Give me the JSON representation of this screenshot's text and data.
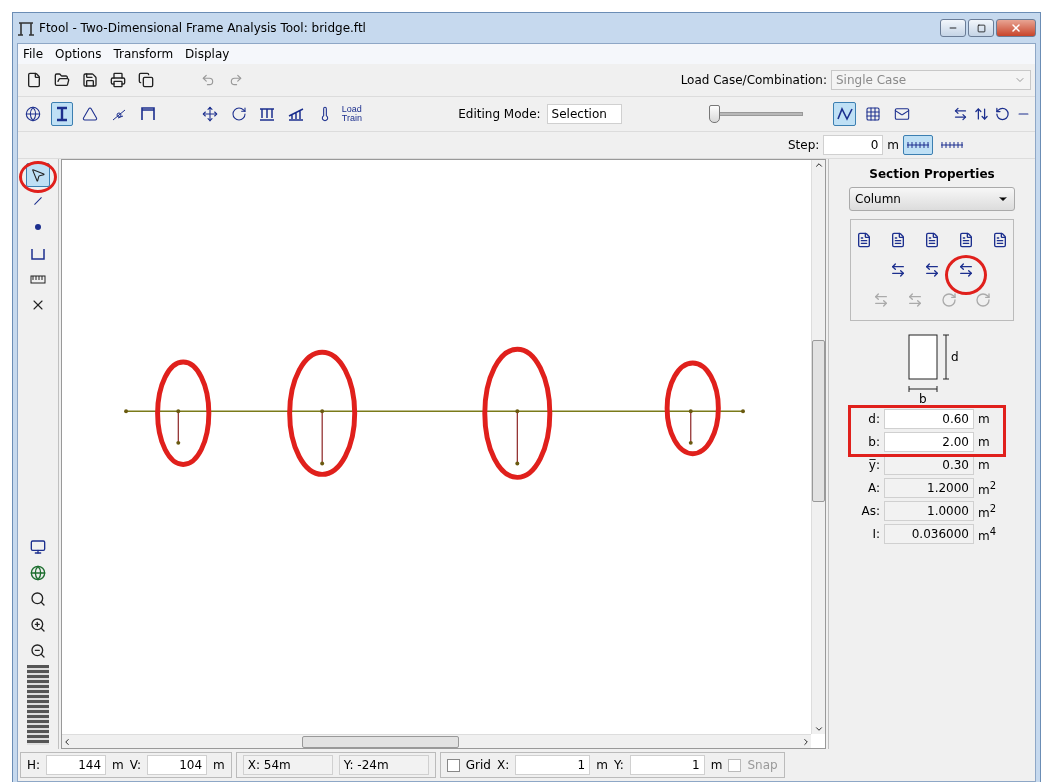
{
  "window": {
    "title": "Ftool - Two-Dimensional Frame Analysis Tool: bridge.ftl"
  },
  "menu": [
    "File",
    "Options",
    "Transform",
    "Display"
  ],
  "load_case": {
    "label": "Load Case/Combination:",
    "value": "Single Case",
    "disabled": true
  },
  "model_tools": [
    {
      "selected": false
    },
    {
      "selected": true
    },
    {
      "selected": false
    },
    {
      "selected": false
    },
    {
      "selected": false
    }
  ],
  "load_tools": [
    {
      "selected": false
    },
    {
      "selected": false
    },
    {
      "selected": false
    },
    {
      "selected": false
    },
    {
      "selected": false
    }
  ],
  "load_train": "Load\nTrain",
  "editing_mode": {
    "label": "Editing Mode:",
    "value": "Selection"
  },
  "slider": {
    "level": 0
  },
  "view_tools": [
    {
      "selected": true
    },
    {
      "selected": false
    },
    {
      "selected": false
    }
  ],
  "step": {
    "label": "Step:",
    "value": "0",
    "unit": "m"
  },
  "step_modes": [
    {
      "selected": true
    },
    {
      "selected": false
    }
  ],
  "side_tools": [
    {
      "selected": true
    },
    {
      "selected": false
    },
    {
      "selected": false
    },
    {
      "selected": false
    },
    {
      "selected": false
    },
    {
      "selected": false
    }
  ],
  "section_properties": {
    "title": "Section Properties",
    "section": "Column",
    "diagram_labels": [
      "d",
      "b"
    ],
    "rows": [
      {
        "label": "d:",
        "value": "0.60",
        "unit": "m",
        "editable": true
      },
      {
        "label": "b:",
        "value": "2.00",
        "unit": "m",
        "editable": true
      },
      {
        "label": "y̅:",
        "value": "0.30",
        "unit": "m",
        "editable": false
      },
      {
        "label": "A:",
        "value": "1.2000",
        "unit": "m$^{2}$",
        "editable": false
      },
      {
        "label": "As:",
        "value": "1.0000",
        "unit": "m$^{2}$",
        "editable": false
      },
      {
        "label": "I:",
        "value": "0.036000",
        "unit": "m$^{4}$",
        "editable": false
      }
    ]
  },
  "status_bar": {
    "h": {
      "label": "H:",
      "value": "144",
      "unit": "m"
    },
    "v": {
      "label": "V:",
      "value": "104",
      "unit": "m"
    },
    "x_coord": "X: 54m",
    "y_coord": "Y: -24m",
    "grid": {
      "label": "Grid",
      "checked": false
    },
    "grid_x": {
      "label": "X:",
      "value": "1",
      "unit": "m"
    },
    "grid_y": {
      "label": "Y:",
      "value": "1",
      "unit": "m"
    },
    "snap": {
      "label": "Snap",
      "checked": false,
      "disabled": true
    }
  }
}
